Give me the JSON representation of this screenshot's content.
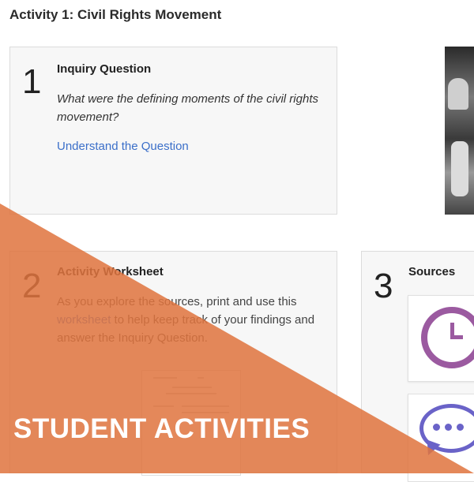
{
  "page": {
    "title": "Activity 1: Civil Rights Movement"
  },
  "step1": {
    "number": "1",
    "heading": "Inquiry Question",
    "question": "What were the defining moments of the civil rights movement?",
    "link": "Understand the Question"
  },
  "step2": {
    "number": "2",
    "heading": "Activity Worksheet",
    "body_before": "As you explore the sources, print and use this ",
    "body_link": "worksheet",
    "body_after": " to help keep track of your findings and answer the Inquiry Question."
  },
  "step3": {
    "number": "3",
    "heading": "Sources",
    "tiles": [
      {
        "icon": "clock-icon"
      },
      {
        "icon": "chat-bubble-icon"
      }
    ]
  },
  "banner": {
    "label": "STUDENT ACTIVITIES",
    "color": "#e0753f"
  },
  "colors": {
    "link": "#3b6fc9",
    "clock": "#9b5aa0",
    "chat": "#6a63c8"
  }
}
